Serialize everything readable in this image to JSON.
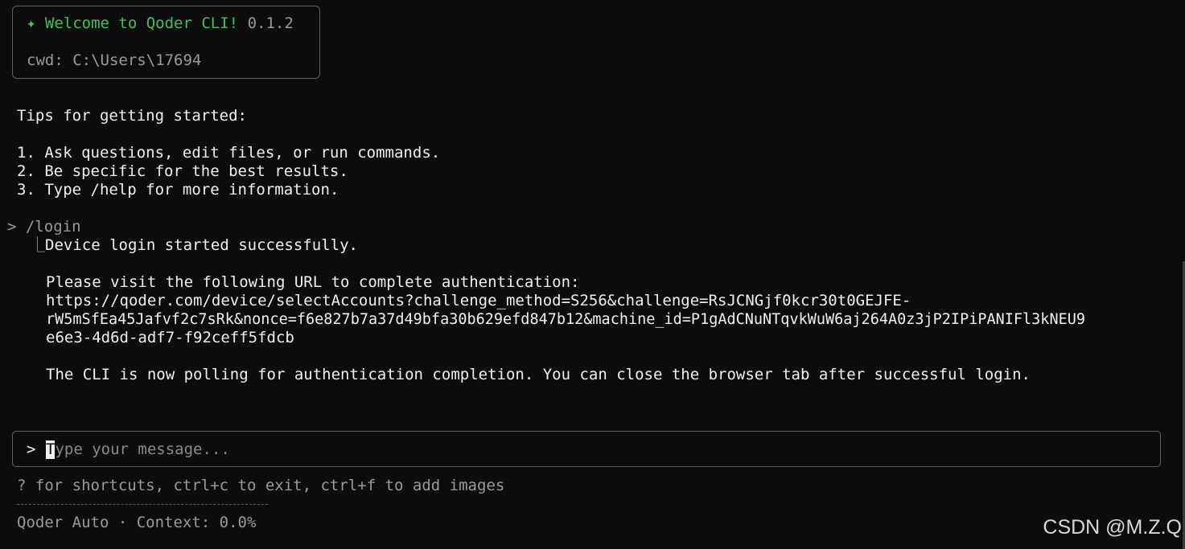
{
  "welcome": {
    "star": "✦",
    "title": "Welcome to Qoder CLI!",
    "version": "0.1.2",
    "cwd": "cwd: C:\\Users\\17694"
  },
  "tips": {
    "heading": "Tips for getting started:",
    "items": [
      "1. Ask questions, edit files, or run commands.",
      "2. Be specific for the best results.",
      "3. Type /help for more information."
    ]
  },
  "history": {
    "prompt_symbol": ">",
    "command": "/login",
    "branch_symbol": "⎿",
    "result": "Device login started successfully.",
    "visit_message": "Please visit the following URL to complete authentication:",
    "url_lines": [
      "https://qoder.com/device/selectAccounts?challenge_method=S256&challenge=RsJCNGjf0kcr30t0GEJFE-",
      "rW5mSfEa45Jafvf2c7sRk&nonce=f6e827b7a37d49bfa30b629efd847b12&machine_id=P1gAdCNuNTqvkWuW6aj264A0z3jP2IPiPANIFl3kNEU9",
      "e6e3-4d6d-adf7-f92ceff5fdcb"
    ],
    "polling_message": "The CLI is now polling for authentication completion. You can close the browser tab after successful login."
  },
  "input": {
    "prompt_symbol": ">",
    "cursor_char": "T",
    "placeholder_rest": "ype your message..."
  },
  "footer": {
    "shortcuts": "? for shortcuts, ctrl+c to exit, ctrl+f to add images",
    "status": "Qoder Auto · Context: 0.0%"
  },
  "watermark": "CSDN @M.Z.Q"
}
